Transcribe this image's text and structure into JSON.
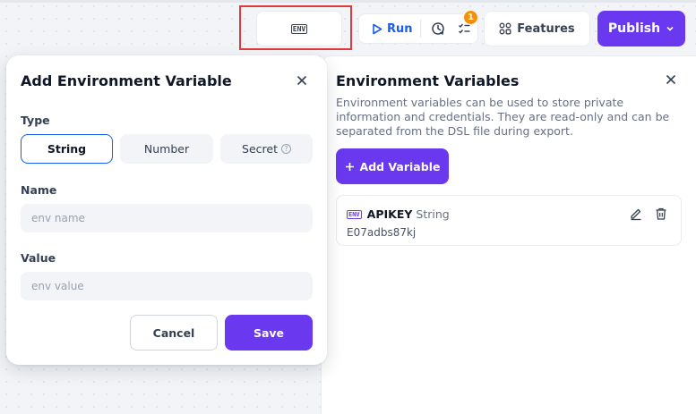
{
  "toolbar": {
    "env_button_icon": "ENV",
    "run_label": "Run",
    "checklist_badge": "1",
    "features_label": "Features",
    "publish_label": "Publish"
  },
  "panel": {
    "title": "Environment Variables",
    "description": "Environment variables can be used to store private information and credentials. They are read-only and can be separated from the DSL file during export.",
    "add_button_label": "Add Variable",
    "variables": [
      {
        "icon": "ENV",
        "name": "APIKEY",
        "type": "String",
        "value": "E07adbs87kj"
      }
    ]
  },
  "dialog": {
    "title": "Add Environment Variable",
    "type_label": "Type",
    "type_options": [
      "String",
      "Number",
      "Secret"
    ],
    "selected_type": "String",
    "name_label": "Name",
    "name_placeholder": "env name",
    "value_label": "Value",
    "value_placeholder": "env value",
    "cancel_label": "Cancel",
    "save_label": "Save"
  },
  "colors": {
    "accent": "#6938ef",
    "run_blue": "#155eef",
    "badge": "#f79009",
    "highlight": "#e03b3b"
  }
}
